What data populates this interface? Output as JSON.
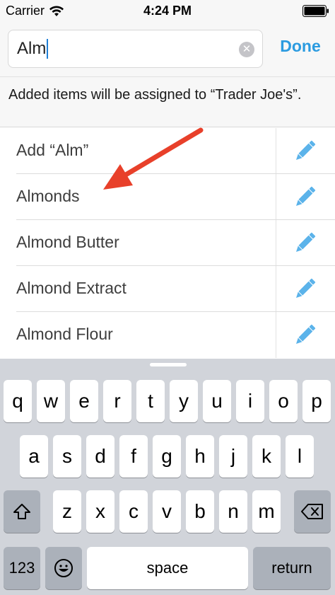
{
  "status_bar": {
    "carrier": "Carrier",
    "time": "4:24 PM"
  },
  "search": {
    "value": "Alm",
    "clear_icon": "clear-circle-icon",
    "done_label": "Done"
  },
  "info_note": "Added items will be assigned to “Trader Joe's”.",
  "suggestions": [
    {
      "label": "Add “Alm”",
      "icon": "pencil-icon"
    },
    {
      "label": "Almonds",
      "icon": "pencil-icon"
    },
    {
      "label": "Almond Butter",
      "icon": "pencil-icon"
    },
    {
      "label": "Almond Extract",
      "icon": "pencil-icon"
    },
    {
      "label": "Almond Flour",
      "icon": "pencil-icon"
    }
  ],
  "colors": {
    "accent": "#2b9be0",
    "pencil": "#5bb3ea",
    "annotation_arrow": "#e8402a",
    "keyboard_bg": "#d1d4da"
  },
  "keyboard": {
    "row1": [
      "q",
      "w",
      "e",
      "r",
      "t",
      "y",
      "u",
      "i",
      "o",
      "p"
    ],
    "row2": [
      "a",
      "s",
      "d",
      "f",
      "g",
      "h",
      "j",
      "k",
      "l"
    ],
    "row3": [
      "z",
      "x",
      "c",
      "v",
      "b",
      "n",
      "m"
    ],
    "numbers_label": "123",
    "space_label": "space",
    "return_label": "return"
  }
}
